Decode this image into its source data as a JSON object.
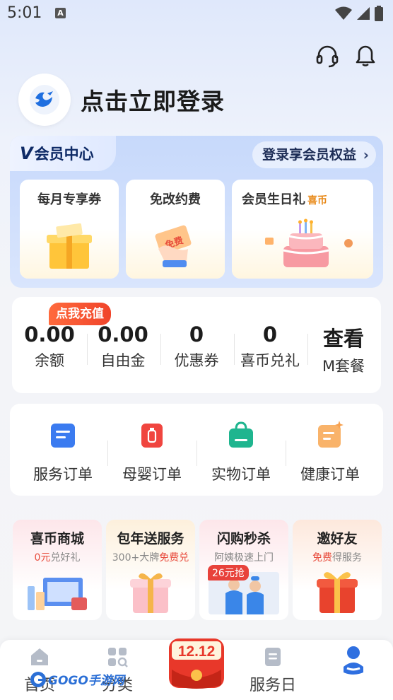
{
  "status_bar": {
    "time": "5:01",
    "notif_letter": "A"
  },
  "header": {
    "icons": [
      "headset-icon",
      "bell-icon"
    ]
  },
  "login": {
    "text": "点击立即登录"
  },
  "vip": {
    "v_letter": "V",
    "title": "会员中心",
    "cta": "登录享会员权益",
    "cta_chevron": "›",
    "perks": [
      {
        "label": "每月专享券",
        "tag": ""
      },
      {
        "label": "免改约费",
        "tag": "",
        "art_text": "免费"
      },
      {
        "label": "会员生日礼",
        "tag": "喜币"
      }
    ]
  },
  "stats": {
    "badge": "点我充值",
    "items": [
      {
        "value": "0.00",
        "label": "余额"
      },
      {
        "value": "0.00",
        "label": "自由金"
      },
      {
        "value": "0",
        "label": "优惠券"
      },
      {
        "value": "0",
        "label": "喜币兑礼"
      },
      {
        "value": "查看",
        "label": "M套餐"
      }
    ]
  },
  "orders": {
    "items": [
      {
        "label": "服务订单",
        "color": "#3b7bf0"
      },
      {
        "label": "母婴订单",
        "color": "#f0453f"
      },
      {
        "label": "实物订单",
        "color": "#1fb58f"
      },
      {
        "label": "健康订单",
        "color": "#f7a04e"
      }
    ]
  },
  "promos": [
    {
      "title": "喜币商城",
      "sub_hl": "0元",
      "sub": "兑好礼",
      "bg": "#fdeef0"
    },
    {
      "title": "包年送服务",
      "sub": "300+大牌",
      "sub_hl": "免费兑",
      "bg": "#fdf3e6"
    },
    {
      "title": "闪购秒杀",
      "sub": "阿姨极速上门",
      "badge": "26元抢",
      "bg": "#fdeef0"
    },
    {
      "title": "邀好友",
      "sub_hl": "免费",
      "sub": "得服务",
      "bg": "#fdefe8"
    }
  ],
  "bottom_nav": {
    "items": [
      {
        "label": "首页",
        "icon": "home-icon"
      },
      {
        "label": "分类",
        "icon": "category-icon"
      },
      {
        "label": "服务日",
        "icon": "service-day-icon"
      },
      {
        "label": "",
        "icon": "profile-icon"
      }
    ],
    "center_badge": "12.12",
    "watermark": "GOGO手游网"
  },
  "colors": {
    "accent_blue": "#1f5fd6",
    "vip_bg": "#c7d9fb",
    "recharge": "#f0442a"
  }
}
